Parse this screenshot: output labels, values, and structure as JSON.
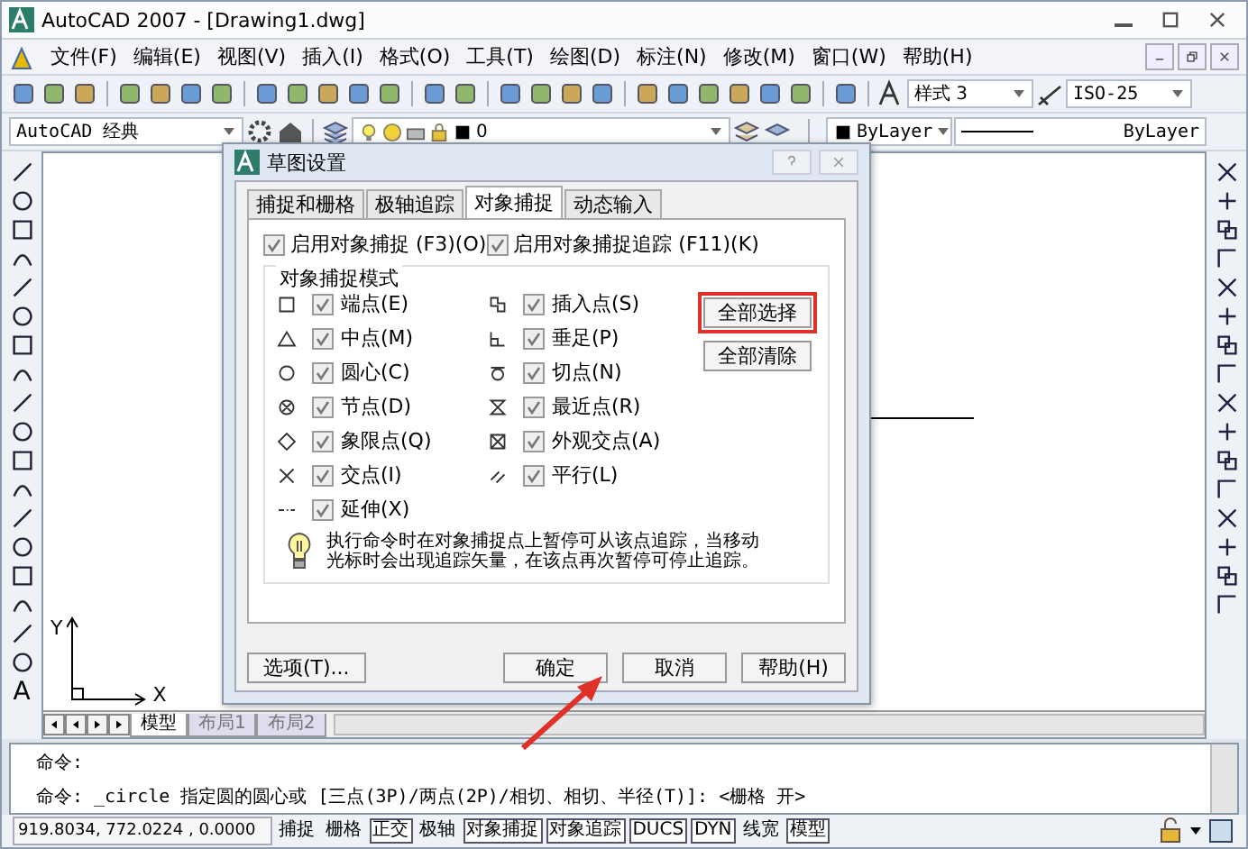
{
  "window": {
    "title": "AutoCAD 2007 - [Drawing1.dwg]"
  },
  "menu": [
    "文件(F)",
    "编辑(E)",
    "视图(V)",
    "插入(I)",
    "格式(O)",
    "工具(T)",
    "绘图(D)",
    "标注(N)",
    "修改(M)",
    "窗口(W)",
    "帮助(H)"
  ],
  "toolbar": {
    "text_style": "样式 3",
    "dim_style": "ISO-25"
  },
  "properties_bar": {
    "workspace": "AutoCAD 经典",
    "layer": "0",
    "color_setting": "ByLayer",
    "linetype": "ByLayer"
  },
  "text_tool_glyph": "A",
  "ucs": {
    "x_label": "X",
    "y_label": "Y"
  },
  "layout_tabs": [
    {
      "label": "模型",
      "selected": true
    },
    {
      "label": "布局1",
      "selected": false
    },
    {
      "label": "布局2",
      "selected": false
    }
  ],
  "command_lines": [
    "命令:",
    "命令: _circle 指定圆的圆心或 [三点(3P)/两点(2P)/相切、相切、半径(T)]:  <栅格 开>"
  ],
  "status_bar": {
    "coordinates": "919.8034,  772.0224 , 0.0000",
    "toggles": [
      {
        "label": "捕捉",
        "on": false
      },
      {
        "label": "栅格",
        "on": false
      },
      {
        "label": "正交",
        "on": true
      },
      {
        "label": "极轴",
        "on": false
      },
      {
        "label": "对象捕捉",
        "on": true
      },
      {
        "label": "对象追踪",
        "on": true
      },
      {
        "label": "DUCS",
        "on": true
      },
      {
        "label": "DYN",
        "on": true
      },
      {
        "label": "线宽",
        "on": false
      },
      {
        "label": "模型",
        "on": true
      }
    ]
  },
  "dialog": {
    "title": "草图设置",
    "tabs": [
      {
        "label": "捕捉和栅格",
        "selected": false
      },
      {
        "label": "极轴追踪",
        "selected": false
      },
      {
        "label": "对象捕捉",
        "selected": true
      },
      {
        "label": "动态输入",
        "selected": false
      }
    ],
    "enable_snap": {
      "label": "启用对象捕捉 (F3)(O)",
      "checked": true
    },
    "enable_tracking": {
      "label": "启用对象捕捉追踪 (F11)(K)",
      "checked": true
    },
    "group_title": "对象捕捉模式",
    "modes_left": [
      {
        "kind": "endpoint",
        "label": "端点(E)",
        "checked": true
      },
      {
        "kind": "midpoint",
        "label": "中点(M)",
        "checked": true
      },
      {
        "kind": "center",
        "label": "圆心(C)",
        "checked": true
      },
      {
        "kind": "node",
        "label": "节点(D)",
        "checked": true
      },
      {
        "kind": "quadrant",
        "label": "象限点(Q)",
        "checked": true
      },
      {
        "kind": "intersection",
        "label": "交点(I)",
        "checked": true
      },
      {
        "kind": "extension",
        "label": "延伸(X)",
        "checked": true
      }
    ],
    "modes_right": [
      {
        "kind": "insertion",
        "label": "插入点(S)",
        "checked": true
      },
      {
        "kind": "perpendicular",
        "label": "垂足(P)",
        "checked": true
      },
      {
        "kind": "tangent",
        "label": "切点(N)",
        "checked": true
      },
      {
        "kind": "nearest",
        "label": "最近点(R)",
        "checked": true
      },
      {
        "kind": "apparent",
        "label": "外观交点(A)",
        "checked": true
      },
      {
        "kind": "parallel",
        "label": "平行(L)",
        "checked": true
      }
    ],
    "select_all": "全部选择",
    "clear_all": "全部清除",
    "tip": "执行命令时在对象捕捉点上暂停可从该点追踪，当移动光标时会出现追踪矢量，在该点再次暂停可停止追踪。",
    "options_button": "选项(T)...",
    "ok_button": "确定",
    "cancel_button": "取消",
    "help_button": "帮助(H)"
  }
}
